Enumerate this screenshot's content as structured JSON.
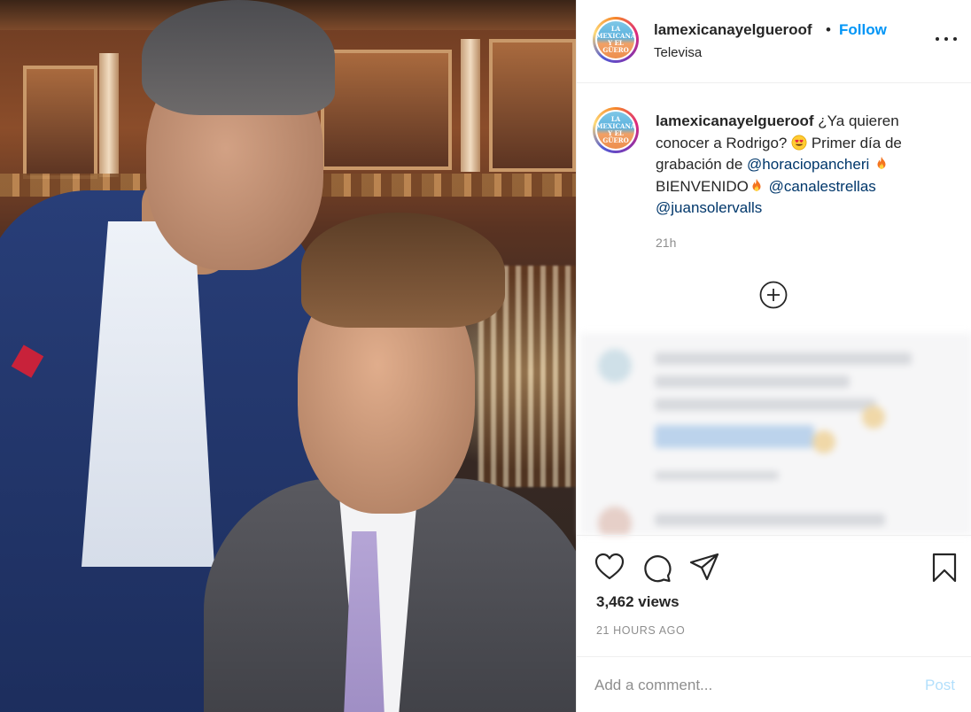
{
  "post": {
    "username": "lamexicanayelgueroof",
    "separator": "•",
    "follow_label": "Follow",
    "location": "Televisa",
    "avatar_logo": "LA MEXICANA Y EL GÜERO",
    "more_icon": "more-horizontal-icon"
  },
  "caption": {
    "username": "lamexicanayelgueroof",
    "text_1": " ¿Ya quieren conocer a Rodrigo? ",
    "emoji_1": "heart-eyes-emoji",
    "text_2": " Primer día de grabación de ",
    "mention_1": "@horaciopancheri",
    "emoji_2": "fire-emoji",
    "text_3": " BIENVENIDO",
    "emoji_3": "fire-emoji",
    "mention_2": "@canalestrellas",
    "mention_3": "@juansolervalls",
    "time_ago": "21h"
  },
  "load_more_icon": "plus-circle-icon",
  "actions": {
    "like_icon": "heart-icon",
    "comment_icon": "comment-icon",
    "share_icon": "send-icon",
    "save_icon": "bookmark-icon",
    "views": "3,462 views",
    "timestamp": "21 HOURS AGO"
  },
  "comment_box": {
    "placeholder": "Add a comment...",
    "post_label": "Post"
  },
  "colors": {
    "accent": "#0095f6",
    "mention": "#00376b",
    "muted": "#8e8e8e",
    "post_disabled": "#b2dffc"
  }
}
